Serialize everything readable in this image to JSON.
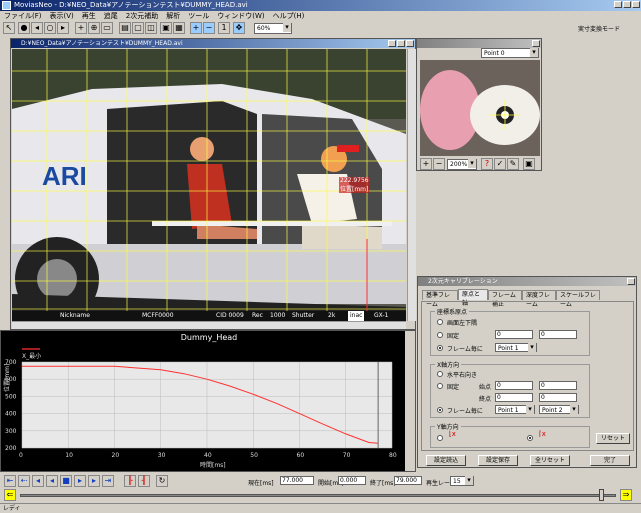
{
  "app": {
    "title": "MoviasNeo - D:¥NEO_Data¥アノテーションテスト¥DUMMY_HEAD.avi"
  },
  "menu": [
    "ファイル(F)",
    "表示(V)",
    "再生",
    "追尾",
    "2次元補助",
    "解析",
    "ツール",
    "ウィンドウ(W)",
    "ヘルプ(H)"
  ],
  "toolbar": {
    "zoom": "60%",
    "mode_label": "実寸変換モード"
  },
  "video_window": {
    "title": "D:¥NEO_Data¥アノテーションテスト¥DUMMY_HEAD.avi",
    "overlay": {
      "car_text": "ARI",
      "measure_value": "222.9756",
      "measure_label": "位置[mm]"
    },
    "strip": {
      "left": "Nickname",
      "file": "MCFF0000",
      "cid": "CID 0009",
      "rec": "Rec",
      "rate": "1000",
      "shutter": "Shutter",
      "shutter_val": "2k",
      "mode": "inac",
      "model": "GX-1"
    }
  },
  "magnifier": {
    "point": "Point 0",
    "zoom": "200%"
  },
  "chart_window": {
    "title": "Dummy_Head"
  },
  "chart_data": {
    "type": "line",
    "title": "Dummy_Head",
    "legend": "X_最小",
    "xlabel": "時間[ms]",
    "ylabel": "位置[mm]",
    "xlim": [
      0,
      80
    ],
    "ylim": [
      200,
      700
    ],
    "x_ticks": [
      0,
      10,
      20,
      30,
      40,
      50,
      60,
      70,
      80
    ],
    "y_ticks": [
      200,
      300,
      400,
      500,
      600,
      700
    ],
    "series": [
      {
        "name": "X_最小",
        "color": "#ff3030",
        "x": [
          0,
          10,
          20,
          30,
          35,
          40,
          45,
          50,
          55,
          60,
          65,
          70,
          75,
          77
        ],
        "y": [
          675,
          675,
          675,
          655,
          632,
          600,
          560,
          512,
          460,
          400,
          340,
          282,
          232,
          228
        ]
      }
    ],
    "cursor_x": 77
  },
  "dialog": {
    "title": "2次元キャリブレーション",
    "tabs": [
      "基準フレーム",
      "原点と軸",
      "フレーム補正",
      "深度フレーム",
      "スケールフレーム"
    ],
    "origin": {
      "label": "座標系原点",
      "opt1": "画面左下隅",
      "opt2": "固定",
      "opt2_x": "0",
      "opt2_y": "0",
      "opt3": "フレーム毎に",
      "opt3_sel": "Point 1"
    },
    "xaxis": {
      "label": "X軸方向",
      "opt1": "水平右向き",
      "opt2": "固定",
      "start": "始点",
      "end": "終点",
      "s_x": "0",
      "s_y": "0",
      "e_x": "0",
      "e_y": "0",
      "opt3": "フレーム毎に",
      "sel1": "Point 1",
      "sel2": "Point 2"
    },
    "yaxis": {
      "label": "Y軸方向",
      "reset": "リセット"
    },
    "buttons": {
      "load": "設定読込",
      "save": "設定保存",
      "reset_all": "全リセット",
      "done": "完了"
    }
  },
  "playback": {
    "now_label": "現在[ms]",
    "now_val": "77.000",
    "start_label": "開始[ms]",
    "start_val": "0.000",
    "end_label": "終了[ms]",
    "end_val": "79.000",
    "rate_label": "再生レート",
    "rate_val": "15"
  },
  "status": {
    "text": "レディ"
  }
}
